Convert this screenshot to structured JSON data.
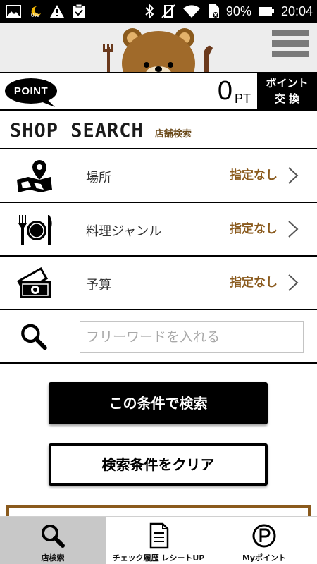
{
  "status_bar": {
    "small_label": "0%",
    "battery": "90%",
    "time": "20:04"
  },
  "points": {
    "badge": "POINT",
    "value": "0",
    "unit": "PT",
    "exchange_line1": "ポイント",
    "exchange_line2": "交 換"
  },
  "section": {
    "title_en": "SHOP SEARCH",
    "title_ja": "店舗検索"
  },
  "filters": [
    {
      "label": "場所",
      "value": "指定なし",
      "icon": "map-pin-icon"
    },
    {
      "label": "料理ジャンル",
      "value": "指定なし",
      "icon": "cutlery-plate-icon"
    },
    {
      "label": "予算",
      "value": "指定なし",
      "icon": "money-icon"
    }
  ],
  "search": {
    "placeholder": "フリーワードを入れる",
    "value": ""
  },
  "buttons": {
    "search": "この条件で検索",
    "clear": "検索条件をクリア"
  },
  "bottom_nav": [
    {
      "label": "店検索",
      "icon": "search-icon",
      "active": true
    },
    {
      "label": "チェック履歴 レシートUP",
      "icon": "document-icon",
      "active": false
    },
    {
      "label": "Myポイント",
      "icon": "point-circle-icon",
      "active": false
    }
  ],
  "colors": {
    "accent_brown": "#8a5a1d",
    "title_brown": "#6b4a1a",
    "active_tab": "#c8c8c8"
  }
}
